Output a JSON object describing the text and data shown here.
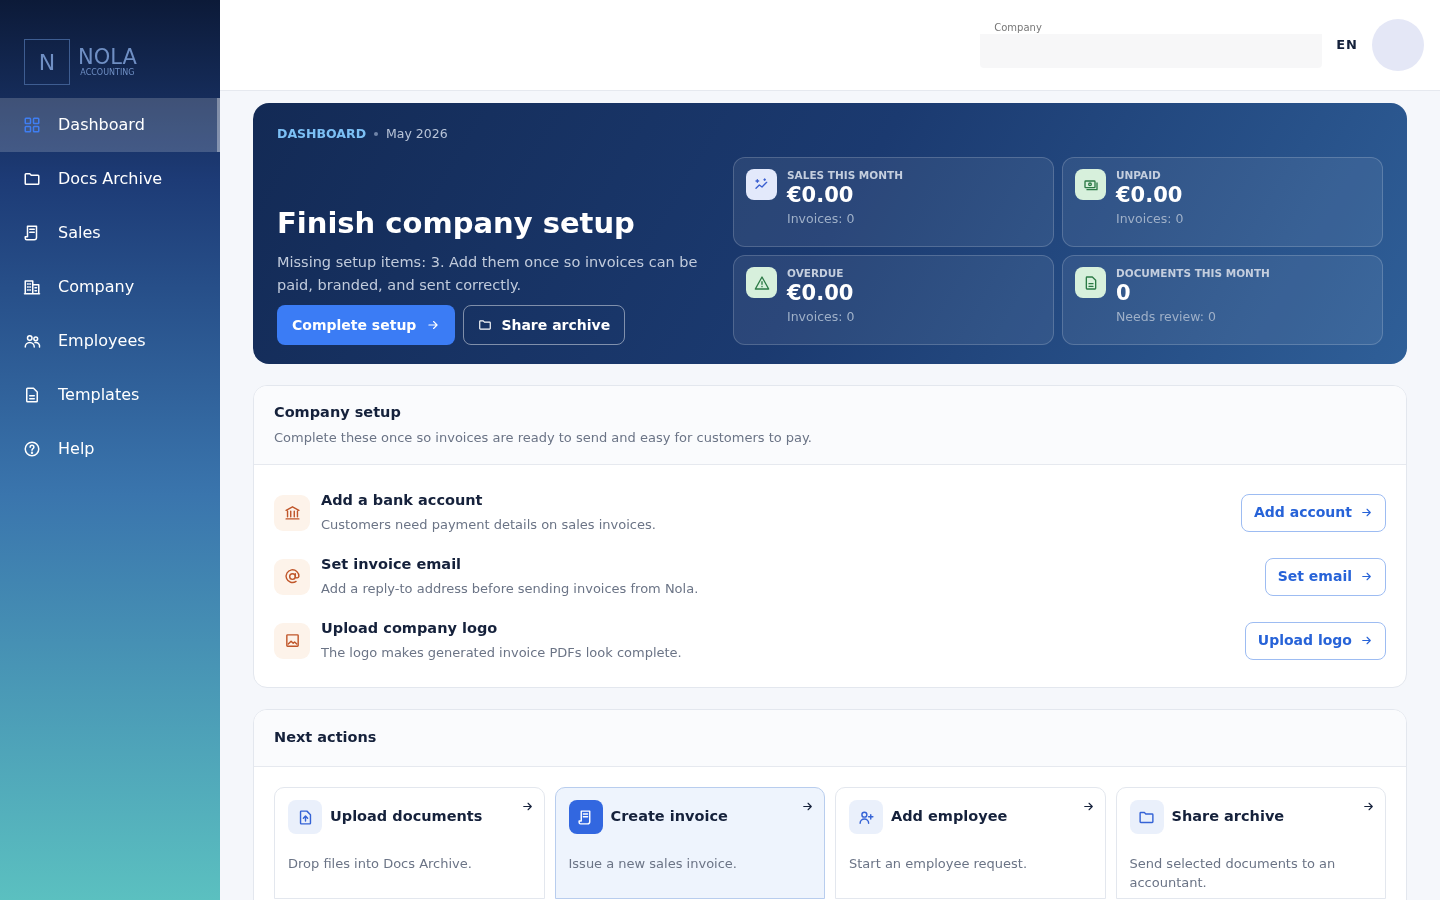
{
  "brand": {
    "letter": "N",
    "name": "NOLA",
    "tagline": "ACCOUNTING"
  },
  "sidebar": {
    "items": [
      {
        "label": "Dashboard",
        "selected": true
      },
      {
        "label": "Docs Archive",
        "selected": false
      },
      {
        "label": "Sales",
        "selected": false
      },
      {
        "label": "Company",
        "selected": false
      },
      {
        "label": "Employees",
        "selected": false
      },
      {
        "label": "Templates",
        "selected": false
      },
      {
        "label": "Help",
        "selected": false
      }
    ]
  },
  "header": {
    "company_label": "Company",
    "language": "EN"
  },
  "hero": {
    "eyebrow": "DASHBOARD",
    "period": "May 2026",
    "title": "Finish company setup",
    "text": "Missing setup items: 3. Add them once so invoices can be paid, branded, and sent correctly.",
    "primary_button": "Complete setup",
    "secondary_button": "Share archive",
    "stats": [
      {
        "label": "SALES THIS MONTH",
        "value": "€0.00",
        "note": "Invoices: 0",
        "color": "#e3e9fb"
      },
      {
        "label": "UNPAID",
        "value": "€0.00",
        "note": "Invoices: 0",
        "color": "#d7f0dc"
      },
      {
        "label": "OVERDUE",
        "value": "€0.00",
        "note": "Invoices: 0",
        "color": "#d7f0dc"
      },
      {
        "label": "DOCUMENTS THIS MONTH",
        "value": "0",
        "note": "Needs review: 0",
        "color": "#d7f0dc"
      }
    ]
  },
  "setup": {
    "title": "Company setup",
    "subtitle": "Complete these once so invoices are ready to send and easy for customers to pay.",
    "items": [
      {
        "title": "Add a bank account",
        "text": "Customers need payment details on sales invoices.",
        "button": "Add account"
      },
      {
        "title": "Set invoice email",
        "text": "Add a reply-to address before sending invoices from Nola.",
        "button": "Set email"
      },
      {
        "title": "Upload company logo",
        "text": "The logo makes generated invoice PDFs look complete.",
        "button": "Upload logo"
      }
    ]
  },
  "next_actions": {
    "title": "Next actions",
    "items": [
      {
        "title": "Upload documents",
        "text": "Drop files into Docs Archive.",
        "selected": false
      },
      {
        "title": "Create invoice",
        "text": "Issue a new sales invoice.",
        "selected": true
      },
      {
        "title": "Add employee",
        "text": "Start an employee request.",
        "selected": false
      },
      {
        "title": "Share archive",
        "text": "Send selected documents to an accountant.",
        "selected": false
      }
    ]
  }
}
